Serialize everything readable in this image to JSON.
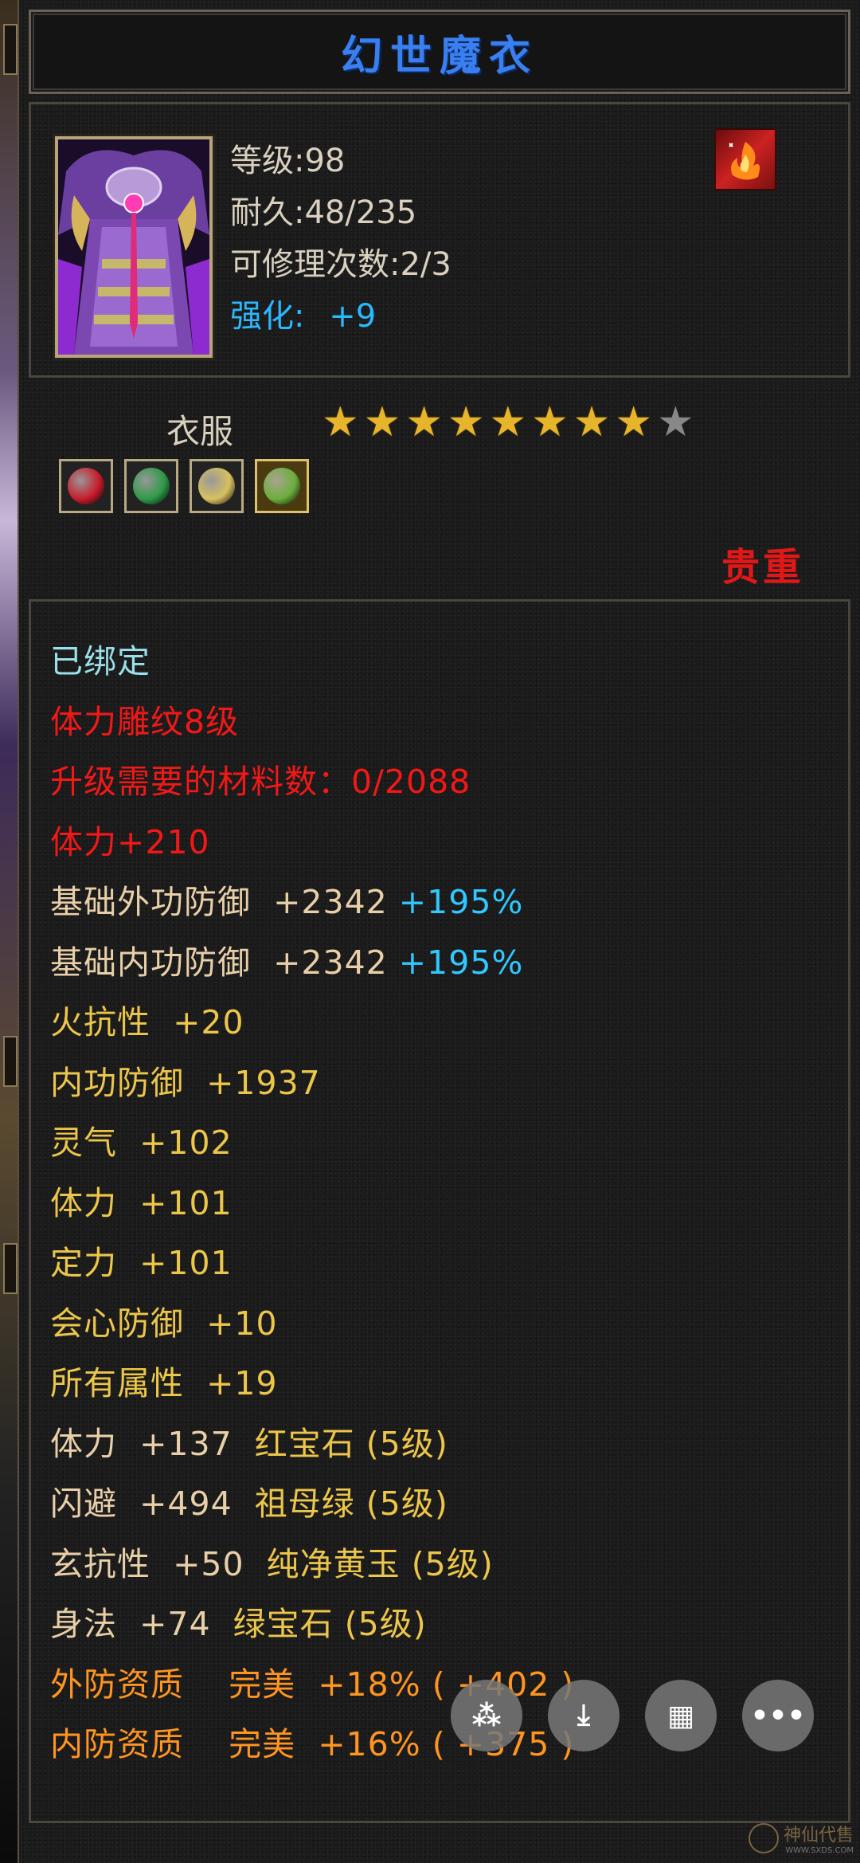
{
  "item": {
    "name": "幻世魔衣",
    "level": "等级:98",
    "durability": "耐久:48/235",
    "repairs": "可修理次数:2/3",
    "enhance_label": "强化:",
    "enhance_value": "+9",
    "type": "衣服",
    "stars_filled": 8,
    "stars_total": 9,
    "rarity": "贵重",
    "gems": [
      {
        "name": "ruby-gem-icon",
        "color": "#c81c2c"
      },
      {
        "name": "jade-gem-icon",
        "color": "#2e9a48"
      },
      {
        "name": "topaz-gem-icon",
        "color": "#d8c060"
      },
      {
        "name": "emerald-gem-icon",
        "color": "#6cae3c"
      }
    ]
  },
  "attributes": [
    {
      "segments": [
        {
          "t": "已绑定",
          "c": "c-cyan"
        }
      ]
    },
    {
      "segments": [
        {
          "t": "体力雕纹8级",
          "c": "c-red"
        }
      ]
    },
    {
      "segments": [
        {
          "t": "升级需要的材料数：0/2088",
          "c": "c-red"
        }
      ]
    },
    {
      "segments": [
        {
          "t": "体力+210",
          "c": "c-red"
        }
      ]
    },
    {
      "segments": [
        {
          "t": "基础外功防御  +2342 ",
          "c": "c-peach"
        },
        {
          "t": "+195%",
          "c": "c-blue"
        }
      ]
    },
    {
      "segments": [
        {
          "t": "基础内功防御  +2342 ",
          "c": "c-peach"
        },
        {
          "t": "+195%",
          "c": "c-blue"
        }
      ]
    },
    {
      "segments": [
        {
          "t": "火抗性  +20",
          "c": "c-yellow"
        }
      ]
    },
    {
      "segments": [
        {
          "t": "内功防御  +1937",
          "c": "c-yellow"
        }
      ]
    },
    {
      "segments": [
        {
          "t": "灵气  +102",
          "c": "c-yellow"
        }
      ]
    },
    {
      "segments": [
        {
          "t": "体力  +101",
          "c": "c-yellow"
        }
      ]
    },
    {
      "segments": [
        {
          "t": "定力  +101",
          "c": "c-yellow"
        }
      ]
    },
    {
      "segments": [
        {
          "t": "会心防御  +10",
          "c": "c-yellow"
        }
      ]
    },
    {
      "segments": [
        {
          "t": "所有属性  +19",
          "c": "c-yellow"
        }
      ]
    },
    {
      "segments": [
        {
          "t": "体力  +137  ",
          "c": "c-peach"
        },
        {
          "t": "红宝石 (5级)",
          "c": "c-yellow"
        }
      ]
    },
    {
      "segments": [
        {
          "t": "闪避  +494  ",
          "c": "c-peach"
        },
        {
          "t": "祖母绿 (5级)",
          "c": "c-yellow"
        }
      ]
    },
    {
      "segments": [
        {
          "t": "玄抗性  +50  ",
          "c": "c-peach"
        },
        {
          "t": "纯净黄玉 (5级)",
          "c": "c-yellow"
        }
      ]
    },
    {
      "segments": [
        {
          "t": "身法  +74  ",
          "c": "c-peach"
        },
        {
          "t": "绿宝石 (5级)",
          "c": "c-yellow"
        }
      ]
    },
    {
      "segments": [
        {
          "t": "外防资质    完美  +18% ( +402 )",
          "c": "c-orange"
        }
      ]
    },
    {
      "segments": [
        {
          "t": "内防资质    完美  +16% ( +375 )",
          "c": "c-orange"
        }
      ]
    }
  ],
  "fabs": [
    {
      "name": "magic-wand-button",
      "glyph": "⁂"
    },
    {
      "name": "download-button",
      "glyph": "⤓"
    },
    {
      "name": "grid-button",
      "glyph": "▦"
    },
    {
      "name": "more-button",
      "glyph": "•••"
    }
  ],
  "watermark": {
    "big": "神仙代售",
    "small": "WWW.SXDS.COM"
  }
}
